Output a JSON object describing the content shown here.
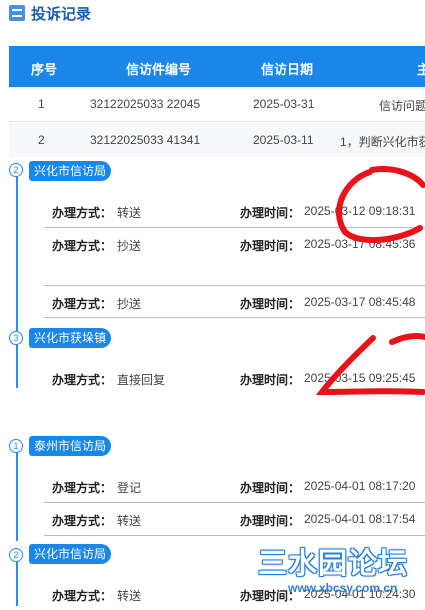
{
  "title": {
    "text": "投诉记录",
    "icon": "document-icon"
  },
  "table": {
    "headers": [
      "序号",
      "信访件编号",
      "信访日期",
      "主"
    ],
    "rows": [
      {
        "no": "1",
        "case_id": "32122025033 22045",
        "date": "2025-03-31",
        "subject": "信访问题"
      },
      {
        "no": "2",
        "case_id": "32122025033 41341",
        "date": "2025-03-11",
        "subject": "1，判断兴化市获"
      }
    ]
  },
  "timeline": {
    "groups": [
      {
        "index": "2",
        "dept": "兴化市信访局",
        "entries": [
          {
            "method_label": "办理方式：",
            "method": "转送",
            "time_label": "办理时间：",
            "time": "2025-03-12 09:18:31"
          },
          {
            "method_label": "办理方式：",
            "method": "抄送",
            "time_label": "办理时间：",
            "time": "2025-03-17 08:45:36"
          },
          {
            "method_label": "办理方式：",
            "method": "抄送",
            "time_label": "办理时间：",
            "time": "2025-03-17 08:45:48"
          }
        ]
      },
      {
        "index": "3",
        "dept": "兴化市获垛镇",
        "entries": [
          {
            "method_label": "办理方式：",
            "method": "直接回复",
            "time_label": "办理时间：",
            "time": "2025-03-15 09:25:45"
          }
        ]
      },
      {
        "index": "1",
        "dept": "泰州市信访局",
        "entries": [
          {
            "method_label": "办理方式：",
            "method": "登记",
            "time_label": "办理时间：",
            "time": "2025-04-01 08:17:20"
          },
          {
            "method_label": "办理方式：",
            "method": "转送",
            "time_label": "办理时间：",
            "time": "2025-04-01 08:17:54"
          }
        ]
      },
      {
        "index": "2",
        "dept": "兴化市信访局",
        "entries": [
          {
            "method_label": "办理方式：",
            "method": "转送",
            "time_label": "办理时间：",
            "time": "2025-04-01 10:24:30"
          }
        ]
      }
    ]
  },
  "watermark": {
    "text": "三水园论坛",
    "url": "www.xbcsy.com.cn"
  },
  "colors": {
    "accent": "#1a86e8",
    "annotation": "#e8131a"
  }
}
